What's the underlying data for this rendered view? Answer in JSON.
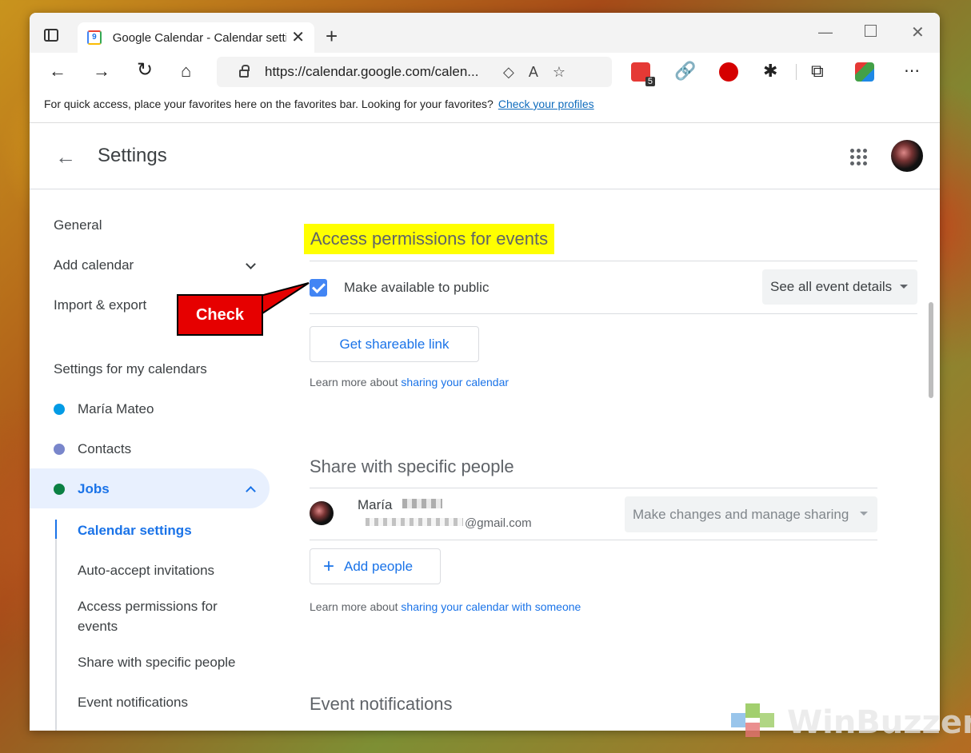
{
  "browser": {
    "tab_title": "Google Calendar - Calendar setti",
    "favicon_label": "9",
    "url": "https://calendar.google.com/calen...",
    "extension_badge": "5",
    "favorites_message": "For quick access, place your favorites here on the favorites bar. Looking for your favorites?",
    "favorites_link": "Check your profiles"
  },
  "header": {
    "title": "Settings"
  },
  "sidebar": {
    "general": "General",
    "add_calendar": "Add calendar",
    "import_export": "Import & export",
    "my_calendars_heading": "Settings for my calendars",
    "calendars": [
      {
        "name": "María Mateo",
        "color": "#039be5"
      },
      {
        "name": "Contacts",
        "color": "#7986cb"
      },
      {
        "name": "Jobs",
        "color": "#0b8043"
      }
    ],
    "sub_items": [
      "Calendar settings",
      "Auto-accept invitations",
      "Access permissions for events",
      "Share with specific people",
      "Event notifications"
    ]
  },
  "main": {
    "access_heading": "Access permissions for events",
    "public_label": "Make available to public",
    "public_checked": true,
    "public_select": "See all event details",
    "shareable_button": "Get shareable link",
    "learn_prefix": "Learn more about ",
    "learn_link_1": "sharing your calendar",
    "share_heading": "Share with specific people",
    "person_name": "María",
    "person_email": "@gmail.com",
    "person_permission": "Make changes and manage sharing",
    "add_people": "Add people",
    "learn_link_2": "sharing your calendar with someone",
    "notifications_heading": "Event notifications"
  },
  "annotation": {
    "callout": "Check",
    "callout_color": "#e60000"
  },
  "watermark": "WinBuzzer",
  "colors": {
    "accent": "#1a73e8",
    "checkbox": "#4285f4",
    "highlight": "#ffff00"
  }
}
